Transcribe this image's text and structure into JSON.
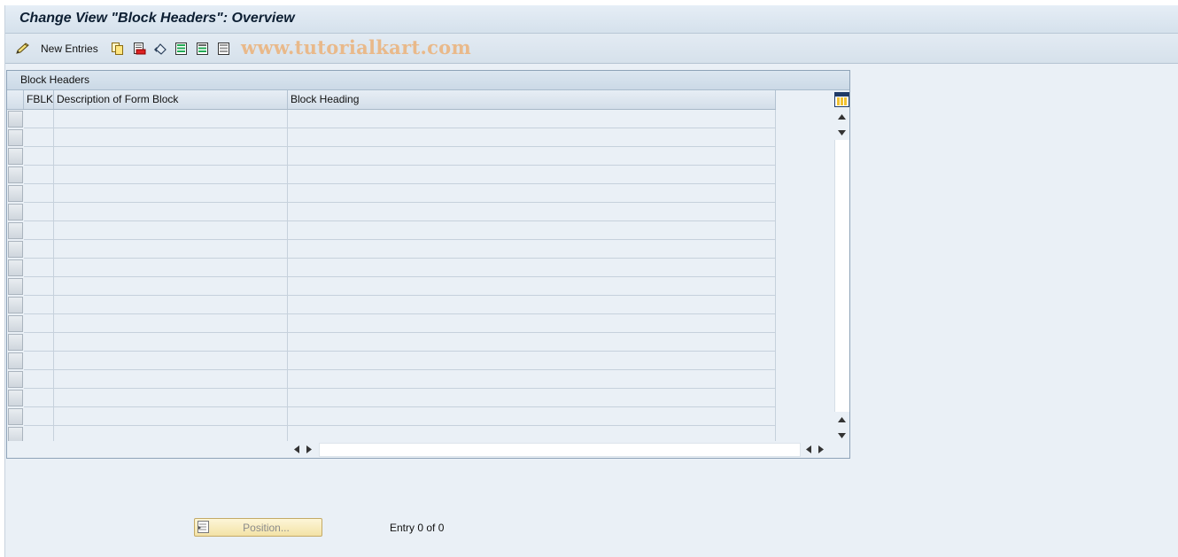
{
  "window": {
    "title": "Change View \"Block Headers\": Overview"
  },
  "toolbar": {
    "watermark": "www.tutorialkart.com",
    "new_entries_label": "New Entries",
    "icons": [
      "pencil-icon",
      "copy-icon",
      "delete-icon",
      "undo-icon",
      "select-all-icon",
      "select-block-icon",
      "deselect-all-icon"
    ]
  },
  "table": {
    "panel_title": "Block Headers",
    "columns": [
      "FBLK",
      "Description of Form Block",
      "Block Heading"
    ],
    "rows": [
      "",
      "",
      "",
      "",
      "",
      "",
      "",
      "",
      "",
      "",
      "",
      "",
      "",
      "",
      "",
      "",
      "",
      ""
    ]
  },
  "footer": {
    "position_label": "Position...",
    "entry_info": "Entry 0 of 0"
  },
  "colors": {
    "background": "#eaf0f6",
    "title_text": "#0d1f33",
    "position_button": "#f6e7b0",
    "watermark": "#e9b98a"
  }
}
